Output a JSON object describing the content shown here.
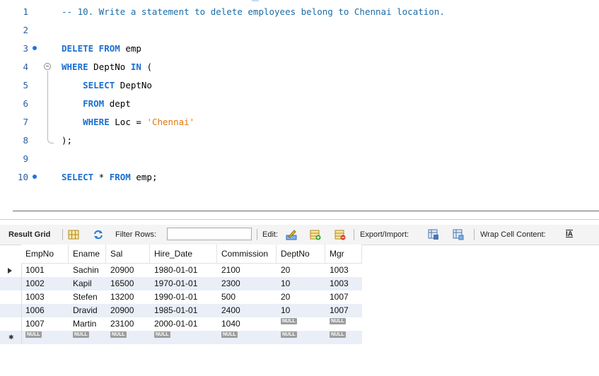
{
  "editor": {
    "lines": [
      {
        "num": "1",
        "segments": [
          {
            "cls": "cm",
            "text": "-- 10. Write a statement to delete employees belong to Chennai location."
          }
        ]
      },
      {
        "num": "2",
        "segments": []
      },
      {
        "num": "3",
        "segments": [
          {
            "cls": "kw",
            "text": "DELETE FROM"
          },
          {
            "cls": "tx",
            "text": " emp"
          }
        ]
      },
      {
        "num": "4",
        "segments": [
          {
            "cls": "kw",
            "text": "WHERE"
          },
          {
            "cls": "tx",
            "text": " DeptNo "
          },
          {
            "cls": "kw",
            "text": "IN"
          },
          {
            "cls": "tx",
            "text": " ("
          }
        ]
      },
      {
        "num": "5",
        "segments": [
          {
            "cls": "tx",
            "text": "    "
          },
          {
            "cls": "kw",
            "text": "SELECT"
          },
          {
            "cls": "tx",
            "text": " DeptNo"
          }
        ]
      },
      {
        "num": "6",
        "segments": [
          {
            "cls": "tx",
            "text": "    "
          },
          {
            "cls": "kw",
            "text": "FROM"
          },
          {
            "cls": "tx",
            "text": " dept"
          }
        ]
      },
      {
        "num": "7",
        "segments": [
          {
            "cls": "tx",
            "text": "    "
          },
          {
            "cls": "kw",
            "text": "WHERE"
          },
          {
            "cls": "tx",
            "text": " Loc = "
          },
          {
            "cls": "st",
            "text": "'Chennai'"
          }
        ]
      },
      {
        "num": "8",
        "segments": [
          {
            "cls": "tx",
            "text": ");"
          }
        ]
      },
      {
        "num": "9",
        "segments": []
      },
      {
        "num": "10",
        "segments": [
          {
            "cls": "kw",
            "text": "SELECT"
          },
          {
            "cls": "tx",
            "text": " * "
          },
          {
            "cls": "kw",
            "text": "FROM"
          },
          {
            "cls": "tx",
            "text": " emp;"
          }
        ]
      }
    ],
    "statement_marker_lines": [
      "3",
      "10"
    ],
    "fold_line": "4"
  },
  "toolbar": {
    "result_grid_label": "Result Grid",
    "filter_rows_label": "Filter Rows:",
    "filter_value": "",
    "edit_label": "Edit:",
    "export_import_label": "Export/Import:",
    "wrap_cell_label": "Wrap Cell Content:",
    "wrap_icon_text": "IA"
  },
  "grid": {
    "columns": [
      "EmpNo",
      "Ename",
      "Sal",
      "Hire_Date",
      "Commission",
      "DeptNo",
      "Mgr"
    ],
    "rows": [
      [
        "1001",
        "Sachin",
        "20900",
        "1980-01-01",
        "2100",
        "20",
        "1003"
      ],
      [
        "1002",
        "Kapil",
        "16500",
        "1970-01-01",
        "2300",
        "10",
        "1003"
      ],
      [
        "1003",
        "Stefen",
        "13200",
        "1990-01-01",
        "500",
        "20",
        "1007"
      ],
      [
        "1006",
        "Dravid",
        "20900",
        "1985-01-01",
        "2400",
        "10",
        "1007"
      ],
      [
        "1007",
        "Martin",
        "23100",
        "2000-01-01",
        "1040",
        "NULL",
        "NULL"
      ]
    ],
    "new_row": [
      "NULL",
      "NULL",
      "NULL",
      "NULL",
      "NULL",
      "NULL",
      "NULL"
    ],
    "null_label": "NULL",
    "selected_row": 0
  },
  "colors": {
    "keyword": "#1a6fd1",
    "comment": "#1b6ca8",
    "string": "#e07810",
    "marker": "#1a73e8",
    "alt_row": "#e9eef7"
  }
}
